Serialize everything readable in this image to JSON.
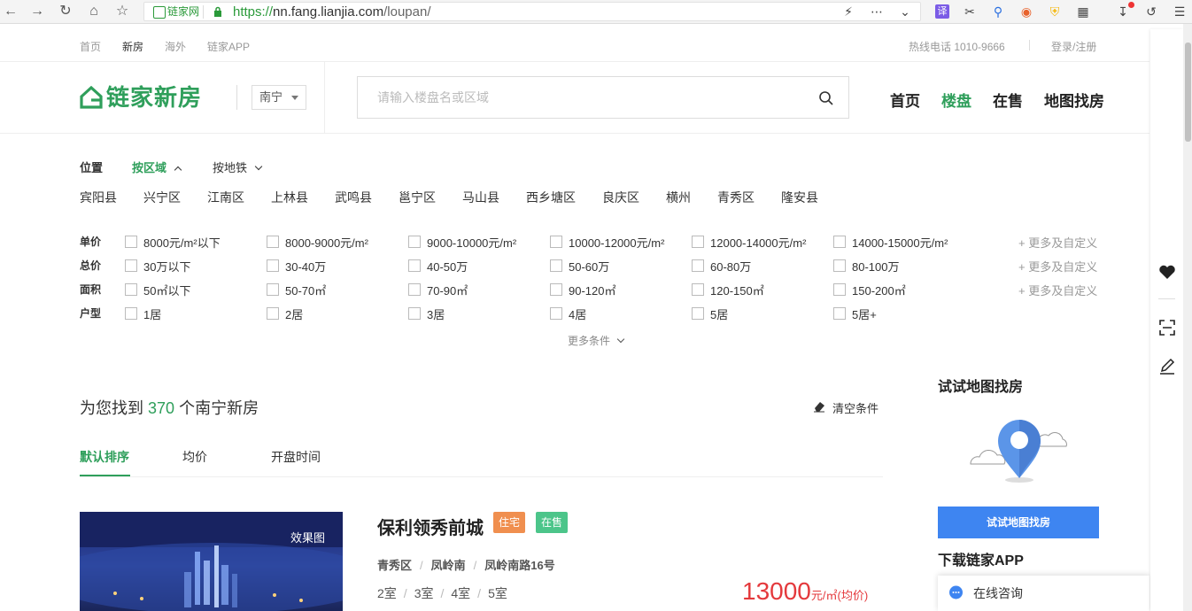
{
  "browser": {
    "site_badge": "链家网",
    "url_scheme": "https://",
    "url_host": "nn.fang.lianjia.com",
    "url_path": "/loupan/"
  },
  "topnav": {
    "items": [
      "首页",
      "新房",
      "海外",
      "链家APP"
    ],
    "hotline": "热线电话 1010-9666",
    "login": "登录/注册"
  },
  "header": {
    "logo_text": "链家新房",
    "city": "南宁",
    "search_placeholder": "请输入楼盘名或区域",
    "nav": [
      "首页",
      "楼盘",
      "在售",
      "地图找房"
    ]
  },
  "filters": {
    "location_label": "位置",
    "tabs": [
      "按区域",
      "按地铁"
    ],
    "districts": [
      "宾阳县",
      "兴宁区",
      "江南区",
      "上林县",
      "武鸣县",
      "邕宁区",
      "马山县",
      "西乡塘区",
      "良庆区",
      "横州",
      "青秀区",
      "隆安县"
    ],
    "rows": [
      {
        "label": "单价",
        "options": [
          "8000元/m²以下",
          "8000-9000元/m²",
          "9000-10000元/m²",
          "10000-12000元/m²",
          "12000-14000元/m²",
          "14000-15000元/m²"
        ],
        "more": "+ 更多及自定义"
      },
      {
        "label": "总价",
        "options": [
          "30万以下",
          "30-40万",
          "40-50万",
          "50-60万",
          "60-80万",
          "80-100万"
        ],
        "more": "+ 更多及自定义"
      },
      {
        "label": "面积",
        "options": [
          "50㎡以下",
          "50-70㎡",
          "70-90㎡",
          "90-120㎡",
          "120-150㎡",
          "150-200㎡"
        ],
        "more": "+ 更多及自定义"
      },
      {
        "label": "户型",
        "options": [
          "1居",
          "2居",
          "3居",
          "4居",
          "5居",
          "5居+"
        ],
        "more": ""
      }
    ],
    "more_conditions": "更多条件"
  },
  "results": {
    "prefix": "为您找到",
    "count": "370",
    "suffix": "个南宁新房",
    "clear": "清空条件",
    "sorts": [
      "默认排序",
      "均价",
      "开盘时间"
    ]
  },
  "listing": {
    "image_label": "效果图",
    "title": "保利领秀前城",
    "tags": [
      {
        "text": "住宅",
        "color": "#f08f4f"
      },
      {
        "text": "在售",
        "color": "#4cc58a"
      }
    ],
    "address": [
      "青秀区",
      "凤岭南",
      "凤岭南路16号"
    ],
    "rooms": [
      "2室",
      "3室",
      "4室",
      "5室"
    ],
    "price": "13000",
    "price_unit": "元/㎡(均价)"
  },
  "sidebar": {
    "map_title": "试试地图找房",
    "map_button": "试试地图找房",
    "app_title": "下载链家APP",
    "consult": "在线咨询"
  },
  "colors": {
    "brand": "#2f9f5b",
    "price": "#e4393c",
    "map_button": "#3e85f1"
  }
}
